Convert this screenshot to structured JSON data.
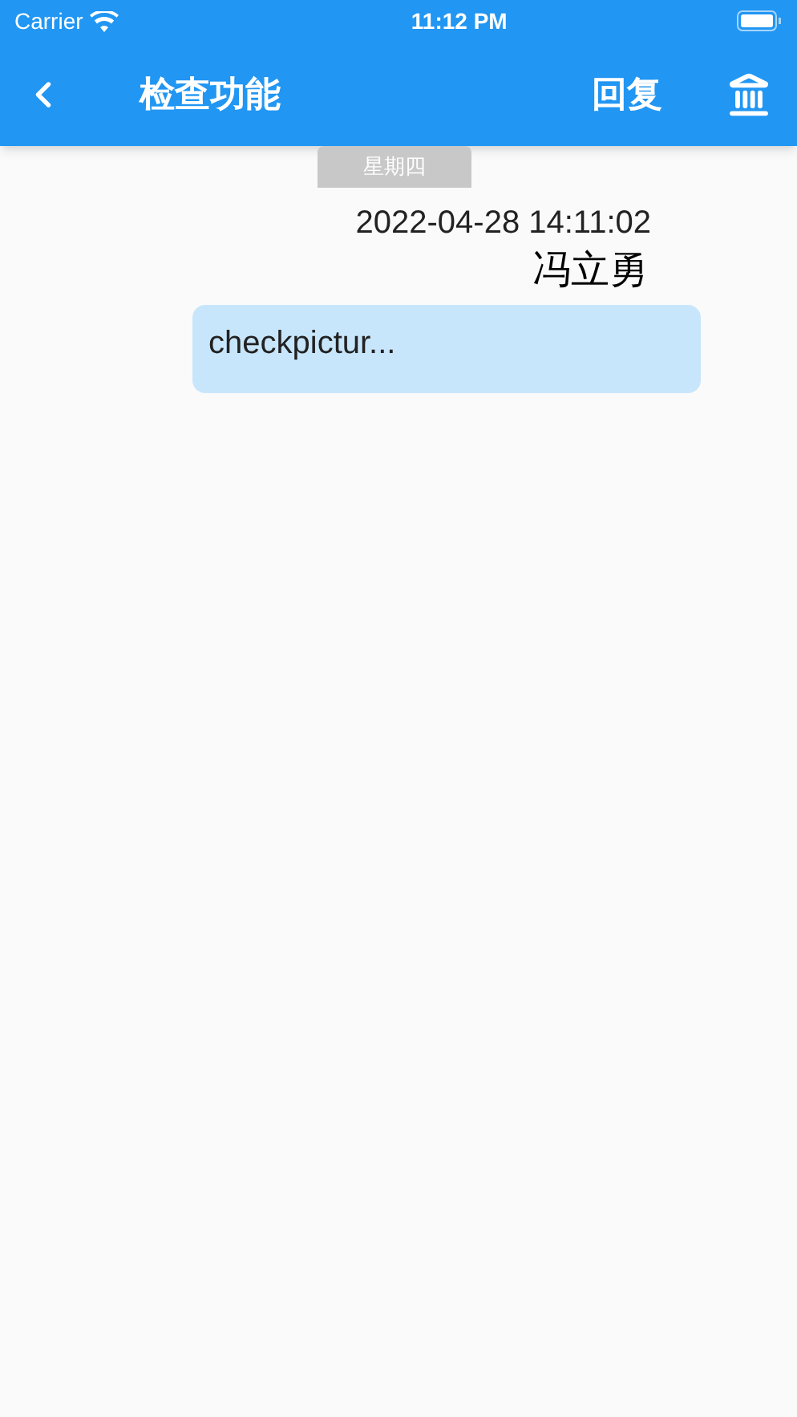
{
  "status_bar": {
    "carrier": "Carrier",
    "time": "11:12 PM"
  },
  "nav_bar": {
    "title": "检查功能",
    "reply_label": "回复"
  },
  "day_tab": "星期四",
  "message": {
    "timestamp": "2022-04-28 14:11:02",
    "sender": "冯立勇",
    "text": "checkpictur..."
  }
}
